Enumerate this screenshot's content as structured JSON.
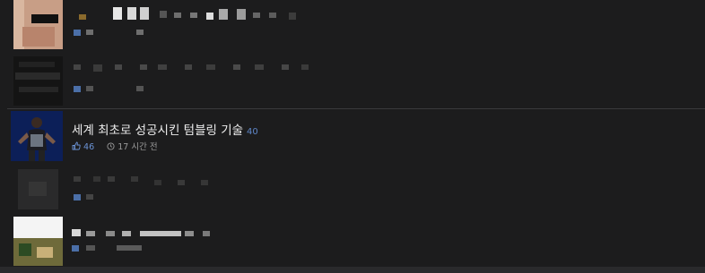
{
  "feed": {
    "focused_item": {
      "title": "세계 최초로 성공시킨 텀블링 기술",
      "comment_count": "40",
      "likes": "46",
      "time_ago": "17 시간 전"
    }
  },
  "icons": {
    "like": "thumbs-up-icon",
    "time": "clock-icon"
  },
  "colors": {
    "background": "#1c1c1d",
    "divider": "#3a3a3c",
    "accent": "#5e86c8",
    "title_text": "#ededed",
    "meta_text": "#9a9a9a"
  }
}
